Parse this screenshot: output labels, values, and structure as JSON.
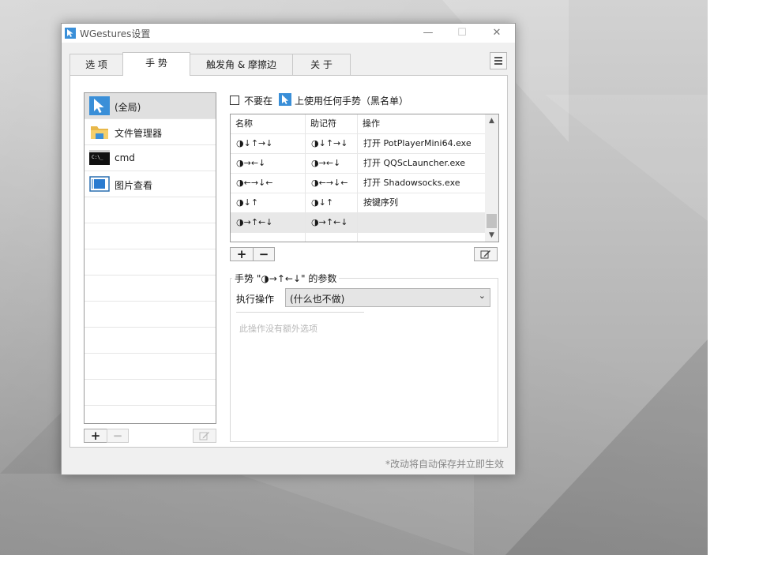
{
  "window": {
    "title": "WGestures设置",
    "controls": {
      "minimize": "—",
      "maximize": "☐",
      "close": "✕"
    }
  },
  "tabs": [
    {
      "label": "选 项",
      "active": false
    },
    {
      "label": "手 势",
      "active": true
    },
    {
      "label": "触发角 & 摩擦边",
      "active": false
    },
    {
      "label": "关 于",
      "active": false
    }
  ],
  "apps": [
    {
      "label": "(全局)",
      "icon": "cursor-icon",
      "selected": true
    },
    {
      "label": "文件管理器",
      "icon": "folder-icon",
      "selected": false
    },
    {
      "label": "cmd",
      "icon": "terminal-icon",
      "selected": false
    },
    {
      "label": "图片查看",
      "icon": "image-viewer-icon",
      "selected": false
    }
  ],
  "app_buttons": {
    "add": "+",
    "remove": "−"
  },
  "blacklist": {
    "checked": false,
    "prefix": "不要在",
    "suffix": "上使用任何手势（黑名单）"
  },
  "table": {
    "headers": [
      "名称",
      "助记符",
      "操作"
    ],
    "rows": [
      {
        "name": "◑↓↑→↓",
        "mnemonic": "◑↓↑→↓",
        "action": "打开 PotPlayerMini64.exe",
        "selected": false
      },
      {
        "name": "◑→←↓",
        "mnemonic": "◑→←↓",
        "action": "打开 QQScLauncher.exe",
        "selected": false
      },
      {
        "name": "◑←→↓←",
        "mnemonic": "◑←→↓←",
        "action": "打开 Shadowsocks.exe",
        "selected": false
      },
      {
        "name": "◑↓↑",
        "mnemonic": "◑↓↑",
        "action": "按键序列",
        "selected": false
      },
      {
        "name": "◑→↑←↓",
        "mnemonic": "◑→↑←↓",
        "action": "",
        "selected": true
      }
    ]
  },
  "gesture_buttons": {
    "add": "+",
    "remove": "−"
  },
  "params": {
    "title": "手势 \"◑→↑←↓\" 的参数",
    "action_label": "执行操作",
    "action_value": "(什么也不做)",
    "hint": "此操作没有额外选项"
  },
  "footer_note": "*改动将自动保存并立即生效",
  "colors": {
    "accent": "#3a8fd8",
    "selected_row": "#e0e0e0",
    "desktop": "#b8b8b8"
  }
}
